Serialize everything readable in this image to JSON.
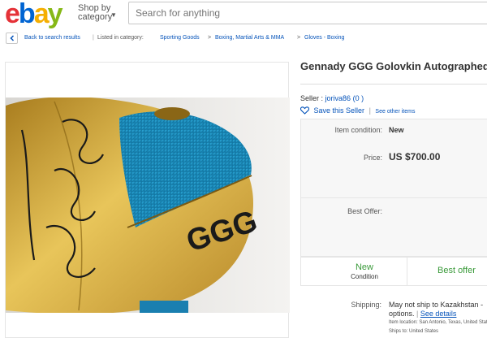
{
  "header": {
    "logo": [
      "e",
      "b",
      "a",
      "y"
    ],
    "shop_by_line1": "Shop by",
    "shop_by_line2": "category",
    "search_placeholder": "Search for anything"
  },
  "breadcrumb": {
    "back": "Back to search results",
    "listed": "Listed in category:",
    "items": [
      "Sporting Goods",
      "Boxing, Martial Arts & MMA",
      "Gloves - Boxing"
    ]
  },
  "item": {
    "title": "Gennady GGG Golovkin Autographed",
    "image_text": "GGG",
    "seller_label": "Seller :",
    "seller_name": "joriva86",
    "seller_feedback": "(0 )",
    "save_seller": "Save this Seller",
    "see_other": "See other items"
  },
  "details": {
    "condition_label": "Item condition:",
    "condition_value": "New",
    "price_label": "Price:",
    "price_value": "US $700.00",
    "best_offer_label": "Best Offer:"
  },
  "condition_strip": {
    "left_top": "New",
    "left_bottom": "Condition",
    "right_top": "Best offer"
  },
  "shipping": {
    "label": "Shipping:",
    "text1": "May not ship to Kazakhstan -",
    "text2": "options.",
    "see_details": "See details",
    "location": "Item location:  San Antonio, Texas, United States",
    "ships_to": "Ships to:  United States"
  },
  "colors": {
    "link": "#0654ba",
    "green": "#3a9a3a",
    "glove_gold": "#d4a83a",
    "glove_blue": "#1a8fc0"
  }
}
